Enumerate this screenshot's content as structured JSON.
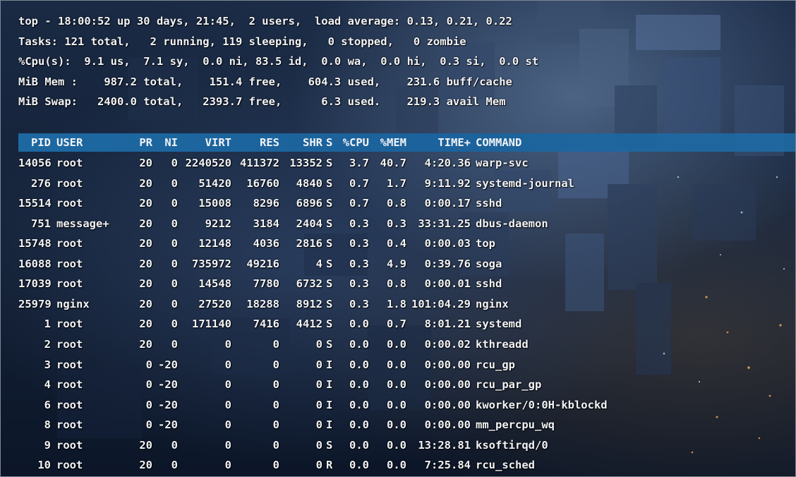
{
  "summary": {
    "line1": "top - 18:00:52 up 30 days, 21:45,  2 users,  load average: 0.13, 0.21, 0.22",
    "line2": "Tasks: 121 total,   2 running, 119 sleeping,   0 stopped,   0 zombie",
    "line3": "%Cpu(s):  9.1 us,  7.1 sy,  0.0 ni, 83.5 id,  0.0 wa,  0.0 hi,  0.3 si,  0.0 st",
    "line4": "MiB Mem :    987.2 total,    151.4 free,    604.3 used,    231.6 buff/cache",
    "line5": "MiB Swap:   2400.0 total,   2393.7 free,      6.3 used.    219.3 avail Mem"
  },
  "columns": {
    "pid": "PID",
    "user": "USER",
    "pr": "PR",
    "ni": "NI",
    "virt": "VIRT",
    "res": "RES",
    "shr": "SHR",
    "s": "S",
    "cpu": "%CPU",
    "mem": "%MEM",
    "time": "TIME+",
    "command": "COMMAND"
  },
  "processes": [
    {
      "pid": "14056",
      "user": "root",
      "pr": "20",
      "ni": "0",
      "virt": "2240520",
      "res": "411372",
      "shr": "13352",
      "s": "S",
      "cpu": "3.7",
      "mem": "40.7",
      "time": "4:20.36",
      "command": "warp-svc"
    },
    {
      "pid": "276",
      "user": "root",
      "pr": "20",
      "ni": "0",
      "virt": "51420",
      "res": "16760",
      "shr": "4840",
      "s": "S",
      "cpu": "0.7",
      "mem": "1.7",
      "time": "9:11.92",
      "command": "systemd-journal"
    },
    {
      "pid": "15514",
      "user": "root",
      "pr": "20",
      "ni": "0",
      "virt": "15008",
      "res": "8296",
      "shr": "6896",
      "s": "S",
      "cpu": "0.7",
      "mem": "0.8",
      "time": "0:00.17",
      "command": "sshd"
    },
    {
      "pid": "751",
      "user": "message+",
      "pr": "20",
      "ni": "0",
      "virt": "9212",
      "res": "3184",
      "shr": "2404",
      "s": "S",
      "cpu": "0.3",
      "mem": "0.3",
      "time": "33:31.25",
      "command": "dbus-daemon"
    },
    {
      "pid": "15748",
      "user": "root",
      "pr": "20",
      "ni": "0",
      "virt": "12148",
      "res": "4036",
      "shr": "2816",
      "s": "S",
      "cpu": "0.3",
      "mem": "0.4",
      "time": "0:00.03",
      "command": "top"
    },
    {
      "pid": "16088",
      "user": "root",
      "pr": "20",
      "ni": "0",
      "virt": "735972",
      "res": "49216",
      "shr": "4",
      "s": "S",
      "cpu": "0.3",
      "mem": "4.9",
      "time": "0:39.76",
      "command": "soga"
    },
    {
      "pid": "17039",
      "user": "root",
      "pr": "20",
      "ni": "0",
      "virt": "14548",
      "res": "7780",
      "shr": "6732",
      "s": "S",
      "cpu": "0.3",
      "mem": "0.8",
      "time": "0:00.01",
      "command": "sshd"
    },
    {
      "pid": "25979",
      "user": "nginx",
      "pr": "20",
      "ni": "0",
      "virt": "27520",
      "res": "18288",
      "shr": "8912",
      "s": "S",
      "cpu": "0.3",
      "mem": "1.8",
      "time": "101:04.29",
      "command": "nginx"
    },
    {
      "pid": "1",
      "user": "root",
      "pr": "20",
      "ni": "0",
      "virt": "171140",
      "res": "7416",
      "shr": "4412",
      "s": "S",
      "cpu": "0.0",
      "mem": "0.7",
      "time": "8:01.21",
      "command": "systemd"
    },
    {
      "pid": "2",
      "user": "root",
      "pr": "20",
      "ni": "0",
      "virt": "0",
      "res": "0",
      "shr": "0",
      "s": "S",
      "cpu": "0.0",
      "mem": "0.0",
      "time": "0:00.02",
      "command": "kthreadd"
    },
    {
      "pid": "3",
      "user": "root",
      "pr": "0",
      "ni": "-20",
      "virt": "0",
      "res": "0",
      "shr": "0",
      "s": "I",
      "cpu": "0.0",
      "mem": "0.0",
      "time": "0:00.00",
      "command": "rcu_gp"
    },
    {
      "pid": "4",
      "user": "root",
      "pr": "0",
      "ni": "-20",
      "virt": "0",
      "res": "0",
      "shr": "0",
      "s": "I",
      "cpu": "0.0",
      "mem": "0.0",
      "time": "0:00.00",
      "command": "rcu_par_gp"
    },
    {
      "pid": "6",
      "user": "root",
      "pr": "0",
      "ni": "-20",
      "virt": "0",
      "res": "0",
      "shr": "0",
      "s": "I",
      "cpu": "0.0",
      "mem": "0.0",
      "time": "0:00.00",
      "command": "kworker/0:0H-kblockd"
    },
    {
      "pid": "8",
      "user": "root",
      "pr": "0",
      "ni": "-20",
      "virt": "0",
      "res": "0",
      "shr": "0",
      "s": "I",
      "cpu": "0.0",
      "mem": "0.0",
      "time": "0:00.00",
      "command": "mm_percpu_wq"
    },
    {
      "pid": "9",
      "user": "root",
      "pr": "20",
      "ni": "0",
      "virt": "0",
      "res": "0",
      "shr": "0",
      "s": "S",
      "cpu": "0.0",
      "mem": "0.0",
      "time": "13:28.81",
      "command": "ksoftirqd/0"
    },
    {
      "pid": "10",
      "user": "root",
      "pr": "20",
      "ni": "0",
      "virt": "0",
      "res": "0",
      "shr": "0",
      "s": "R",
      "cpu": "0.0",
      "mem": "0.0",
      "time": "7:25.84",
      "command": "rcu_sched"
    }
  ],
  "colors": {
    "text": "#f2f4f7",
    "header_bar": "#1e6eaa",
    "background": "#142238"
  }
}
